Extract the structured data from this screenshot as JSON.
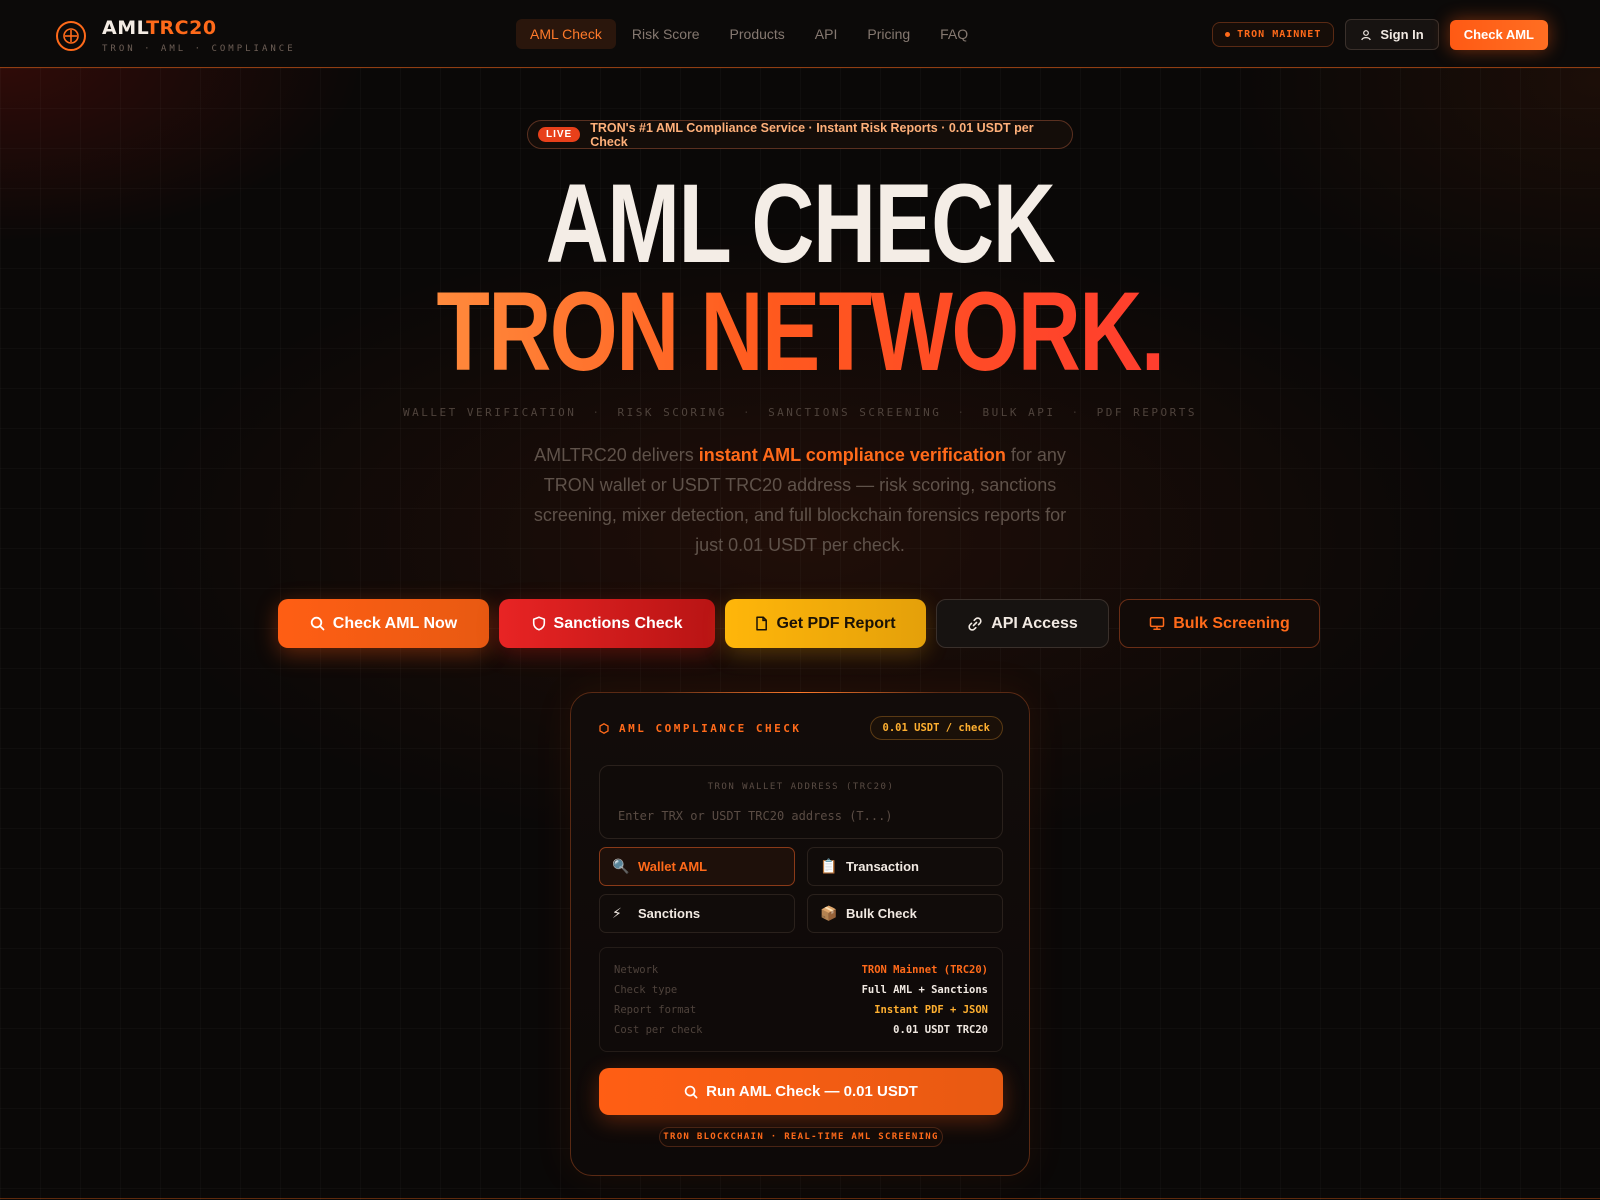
{
  "colors": {
    "accent": "#ff6a1a",
    "red": "#e82424",
    "gold": "#ffb60a",
    "background": "#0a0807"
  },
  "brand": {
    "name_part1": "AML",
    "name_part2": "TRC20",
    "tagline": "TRON · AML · COMPLIANCE",
    "icon": "compass-target-icon"
  },
  "nav": {
    "links": [
      "AML Check",
      "Risk Score",
      "Products",
      "API",
      "Pricing",
      "FAQ"
    ],
    "active": "AML Check",
    "network_badge": "TRON MAINNET",
    "signin_label": "Sign In",
    "cta_label": "Check AML"
  },
  "hero": {
    "live_tag": "LIVE",
    "live_text": "TRON's #1 AML Compliance Service · Instant Risk Reports · 0.01 USDT per Check",
    "title_line1": "AML CHECK",
    "title_line2": "TRON NETWORK.",
    "tags": [
      "WALLET VERIFICATION",
      "RISK SCORING",
      "SANCTIONS SCREENING",
      "BULK API",
      "PDF REPORTS"
    ],
    "tag_separator": "·",
    "lead_pre": "AMLTRC20 delivers ",
    "lead_highlight": "instant AML compliance verification",
    "lead_post": " for any TRON wallet or USDT TRC20 address — risk scoring, sanctions screening, mixer detection, and full blockchain forensics reports for just 0.01 USDT per check."
  },
  "cta_buttons": [
    {
      "label": "Check AML Now",
      "icon": "search-icon"
    },
    {
      "label": "Sanctions Check",
      "icon": "shield-icon"
    },
    {
      "label": "Get PDF Report",
      "icon": "document-icon"
    },
    {
      "label": "API Access",
      "icon": "link-icon"
    },
    {
      "label": "Bulk Screening",
      "icon": "monitor-icon"
    }
  ],
  "card": {
    "title": "AML COMPLIANCE CHECK",
    "title_icon": "hexagon-icon",
    "price": "0.01 USDT / check",
    "address_label": "TRON WALLET ADDRESS (TRC20)",
    "address_placeholder": "Enter TRX or USDT TRC20 address (T...)",
    "address_value": "",
    "options": [
      {
        "label": "Wallet AML",
        "glyph": "🔍",
        "icon": "magnifier-emoji-icon",
        "selected": true
      },
      {
        "label": "Transaction",
        "glyph": "📋",
        "icon": "clipboard-emoji-icon",
        "selected": false
      },
      {
        "label": "Sanctions",
        "glyph": "⚡",
        "icon": "lightning-emoji-icon",
        "selected": false
      },
      {
        "label": "Bulk Check",
        "glyph": "📦",
        "icon": "package-emoji-icon",
        "selected": false
      }
    ],
    "info": [
      {
        "key": "Network",
        "value": "TRON Mainnet (TRC20)",
        "color": "#ff6a1a"
      },
      {
        "key": "Check type",
        "value": "Full AML + Sanctions",
        "color": "#f1e9e2"
      },
      {
        "key": "Report format",
        "value": "Instant PDF + JSON",
        "color": "#ffb030"
      },
      {
        "key": "Cost per check",
        "value": "0.01 USDT TRC20",
        "color": "#f1e9e2"
      }
    ],
    "run_label": "Run AML Check — 0.01 USDT",
    "footer": "TRON BLOCKCHAIN · REAL-TIME AML SCREENING"
  }
}
